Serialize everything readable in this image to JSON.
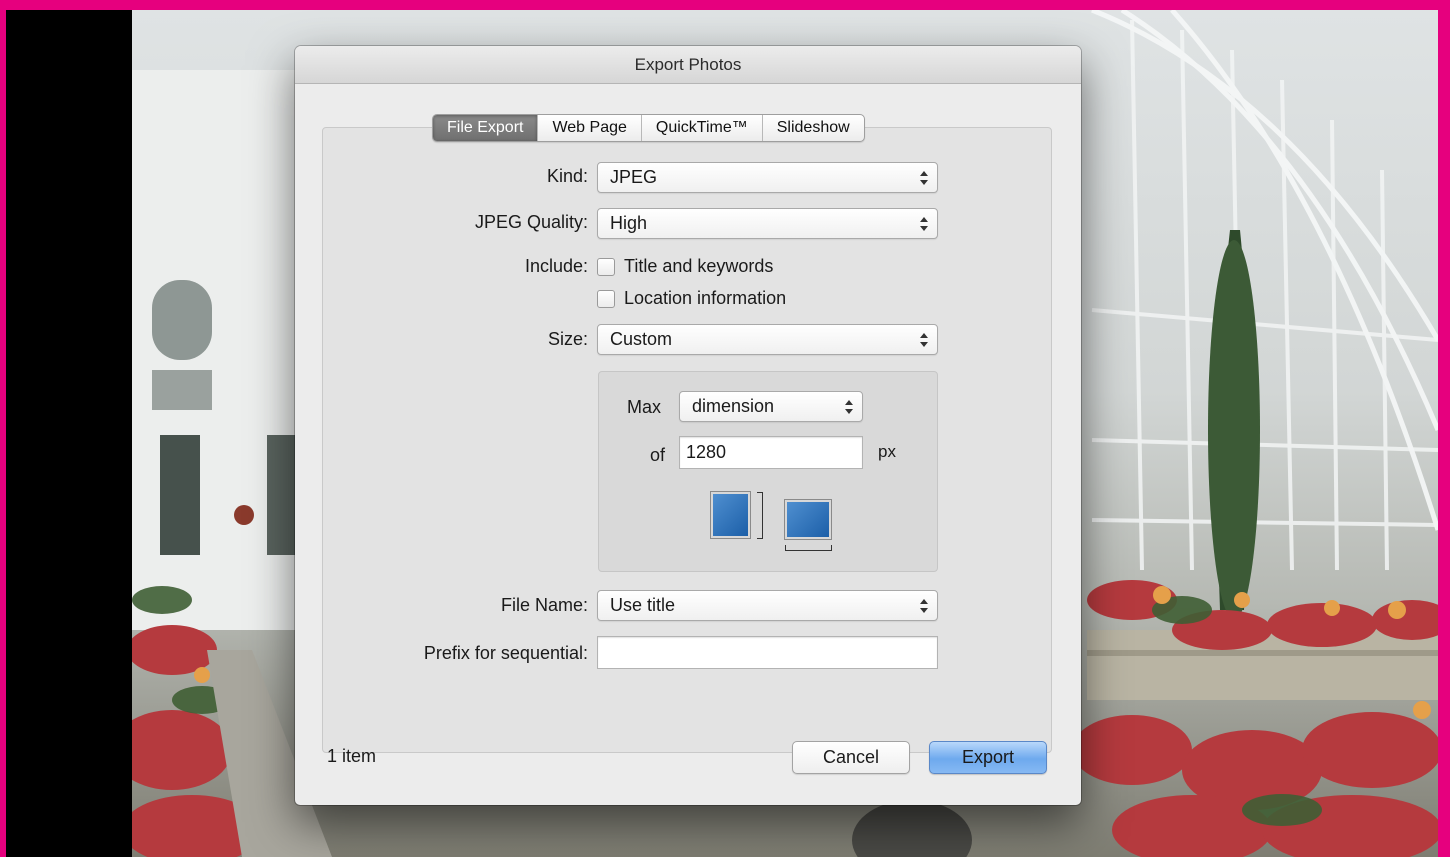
{
  "window": {
    "title": "Export Photos"
  },
  "tabs": [
    {
      "label": "File Export",
      "selected": true
    },
    {
      "label": "Web Page",
      "selected": false
    },
    {
      "label": "QuickTime™",
      "selected": false
    },
    {
      "label": "Slideshow",
      "selected": false
    }
  ],
  "form": {
    "kind": {
      "label": "Kind:",
      "value": "JPEG"
    },
    "jpeg_quality": {
      "label": "JPEG Quality:",
      "value": "High"
    },
    "include": {
      "label": "Include:",
      "options": [
        {
          "label": "Title and keywords",
          "checked": false
        },
        {
          "label": "Location information",
          "checked": false
        }
      ]
    },
    "size": {
      "label": "Size:",
      "value": "Custom"
    },
    "custom_size": {
      "max_label": "Max",
      "max_value": "dimension",
      "of_label": "of",
      "of_value": "1280",
      "unit": "px"
    },
    "file_name": {
      "label": "File Name:",
      "value": "Use title"
    },
    "prefix": {
      "label": "Prefix for sequential:",
      "value": ""
    }
  },
  "footer": {
    "count": "1 item",
    "cancel_label": "Cancel",
    "export_label": "Export"
  },
  "colors": {
    "frame_border": "#e6007e",
    "export_button": "#6ea9ee",
    "selected_tab": "#7a7a7a"
  }
}
